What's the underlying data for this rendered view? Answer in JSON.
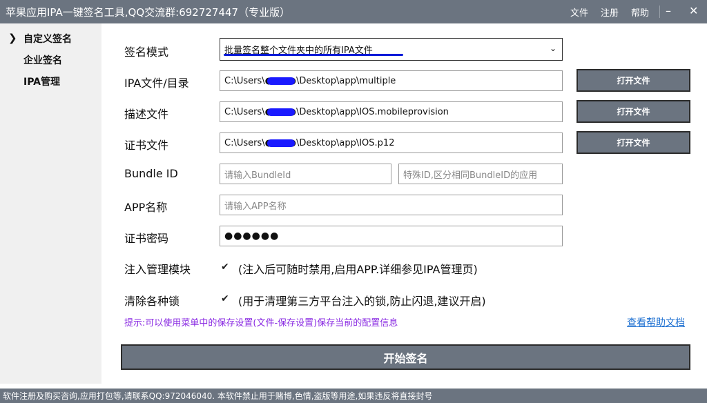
{
  "window": {
    "title": "苹果应用IPA一键签名工具,QQ交流群:692727447（专业版）",
    "menu": [
      "文件",
      "注册",
      "帮助"
    ],
    "minimize_glyph": "–",
    "close_glyph": "✕"
  },
  "sidebar": {
    "items": [
      {
        "label": "自定义签名",
        "selected": true
      },
      {
        "label": "企业签名",
        "selected": false
      },
      {
        "label": "IPA管理",
        "selected": false
      }
    ]
  },
  "form": {
    "sign_mode": {
      "label": "签名模式",
      "value": "批量签名整个文件夹中的所有IPA文件"
    },
    "ipa_path": {
      "label": "IPA文件/目录",
      "value": "C:\\Users\\●●●●\\Desktop\\app\\multiple",
      "button": "打开文件"
    },
    "profile_path": {
      "label": "描述文件",
      "value": "C:\\Users\\●●●●\\Desktop\\app\\IOS.mobileprovision",
      "button": "打开文件"
    },
    "cert_path": {
      "label": "证书文件",
      "value": "C:\\Users\\●●●●\\Desktop\\app\\IOS.p12",
      "button": "打开文件"
    },
    "bundle_id": {
      "label": "Bundle ID",
      "placeholder": "请输入BundleId",
      "special_placeholder": "特殊ID,区分相同BundleID的应用"
    },
    "app_name": {
      "label": "APP名称",
      "placeholder": "请输入APP名称"
    },
    "cert_password": {
      "label": "证书密码",
      "value": "●●●●●●"
    },
    "inject_module": {
      "label": "注入管理模块",
      "checked": true,
      "text": "(注入后可随时禁用,启用APP.详细参见IPA管理页)"
    },
    "clear_locks": {
      "label": "清除各种锁",
      "checked": true,
      "text": "(用于清理第三方平台注入的锁,防止闪退,建议开启)"
    },
    "tip": "提示:可以使用菜单中的保存设置(文件-保存设置)保存当前的配置信息",
    "help_link": "查看帮助文档",
    "start_button": "开始签名"
  },
  "status_bar": "软件注册及购买咨询,应用打包等,请联系QQ:972046040.  本软件禁止用于赌博,色情,盗版等用途,如果违反将直接封号",
  "colors": {
    "chrome": "#6b7480",
    "tip": "#8a2be2",
    "link": "#1c6fd1",
    "redaction": "#1a1aff"
  },
  "icons": {
    "selected_marker": "chevron-right-icon",
    "checkbox": "checkmark-icon",
    "dropdown": "chevron-down-icon"
  }
}
